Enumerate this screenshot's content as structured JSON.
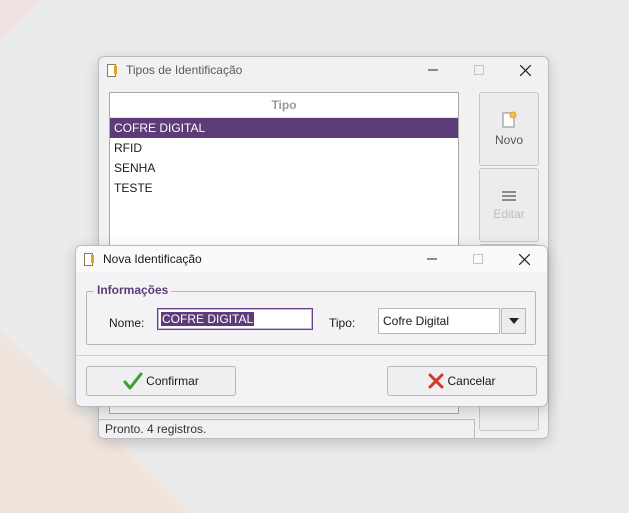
{
  "main_window": {
    "title": "Tipos de Identificação",
    "list": {
      "header": "Tipo",
      "items": [
        "COFRE DIGITAL",
        "RFID",
        "SENHA",
        "TESTE"
      ],
      "selected_index": 0
    },
    "buttons": {
      "new_label": "Novo",
      "edit_label": "Editar"
    },
    "status": "Pronto. 4 registros."
  },
  "dialog": {
    "title": "Nova Identificação",
    "group_title": "Informações",
    "name_label": "Nome:",
    "name_value": "COFRE DIGITAL",
    "type_label": "Tipo:",
    "type_value": "Cofre Digital",
    "confirm_label": "Confirmar",
    "cancel_label": "Cancelar"
  },
  "colors": {
    "accent": "#5b3b78",
    "confirm_icon": "#3aa12e",
    "cancel_icon": "#d23a2a"
  },
  "icons": {
    "app": "document-key-icon",
    "new": "new-document-icon",
    "edit": "list-lines-icon",
    "confirm": "check-icon",
    "cancel": "x-icon",
    "dropdown": "triangle-down-icon"
  }
}
